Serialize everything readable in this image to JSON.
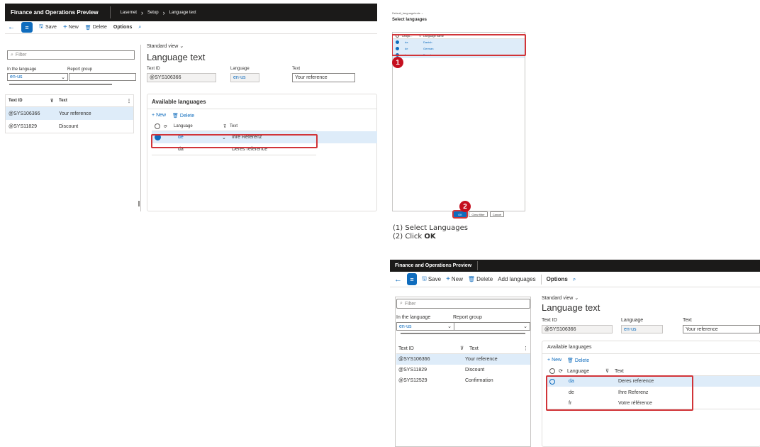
{
  "shot1": {
    "title": "Finance and Operations Preview",
    "breadcrumb": [
      "Lasernet",
      "Setup",
      "Language text"
    ],
    "toolbar": {
      "save": "Save",
      "new": "New",
      "delete": "Delete",
      "options": "Options"
    },
    "filter_placeholder": "Filter",
    "in_language_label": "In the language",
    "in_language_value": "en-us",
    "report_group_label": "Report group",
    "list_headers": {
      "id": "Text ID",
      "text": "Text"
    },
    "list_rows": [
      {
        "id": "@SYS106366",
        "text": "Your reference"
      },
      {
        "id": "@SYS11829",
        "text": "Discount"
      }
    ],
    "view": "Standard view",
    "page_title": "Language text",
    "field_textid_label": "Text ID",
    "field_textid_value": "@SYS106366",
    "field_language_label": "Language",
    "field_language_value": "en-us",
    "field_text_label": "Text",
    "field_text_value": "Your reference",
    "section_title": "Available languages",
    "section_new": "New",
    "section_delete": "Delete",
    "grid_headers": {
      "language": "Language",
      "text": "Text"
    },
    "grid_rows": [
      {
        "language": "de",
        "text": "Ihre Referenz"
      },
      {
        "language": "da",
        "text": "Deres reference"
      }
    ]
  },
  "dialog": {
    "subtitle": "Default_languagetexts",
    "title": "Select languages",
    "headers": {
      "lang": "Langu...",
      "name": "Language name"
    },
    "rows": [
      {
        "lang": "da",
        "name": "Danish"
      },
      {
        "lang": "de",
        "name": "German"
      },
      {
        "lang": "fr",
        "name": "French"
      }
    ],
    "ok": "OK",
    "clear_filter": "Clear filter",
    "cancel": "Cancel",
    "badge1": "1",
    "badge2": "2"
  },
  "caption": {
    "line1": "(1) Select Languages",
    "line2_prefix": "(2) Click ",
    "line2_bold": "OK"
  },
  "shot2": {
    "title": "Finance and Operations Preview",
    "toolbar": {
      "save": "Save",
      "new": "New",
      "delete": "Delete",
      "add_languages": "Add languages",
      "options": "Options"
    },
    "filter_placeholder": "Filter",
    "in_language_label": "In the language",
    "in_language_value": "en-us",
    "report_group_label": "Report group",
    "list_headers": {
      "id": "Text ID",
      "text": "Text"
    },
    "list_rows": [
      {
        "id": "@SYS106366",
        "text": "Your reference"
      },
      {
        "id": "@SYS11829",
        "text": "Discount"
      },
      {
        "id": "@SYS12529",
        "text": "Confirmation"
      }
    ],
    "view": "Standard view",
    "page_title": "Language text",
    "field_textid_label": "Text ID",
    "field_textid_value": "@SYS106366",
    "field_language_label": "Language",
    "field_language_value": "en-us",
    "field_text_label": "Text",
    "field_text_value": "Your reference",
    "section_title": "Available languages",
    "section_new": "New",
    "section_delete": "Delete",
    "grid_headers": {
      "language": "Language",
      "text": "Text"
    },
    "grid_rows": [
      {
        "language": "da",
        "text": "Deres reference"
      },
      {
        "language": "de",
        "text": "Ihre Referenz"
      },
      {
        "language": "fr",
        "text": "Votre référence"
      }
    ]
  }
}
